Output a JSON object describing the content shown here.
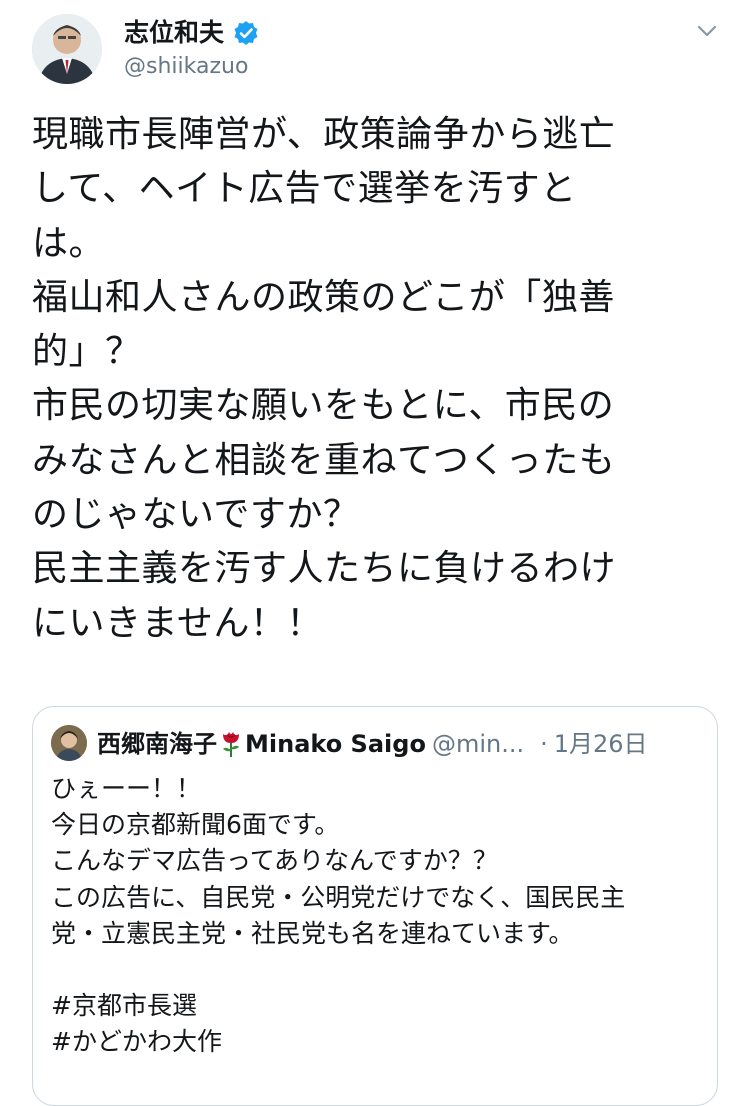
{
  "author": {
    "display_name": "志位和夫",
    "handle": "@shiikazuo",
    "verified": true
  },
  "tweet": {
    "text": "現職市長陣営が、政策論争から逃亡\nして、ヘイト広告で選挙を汚すと\nは。\n福山和人さんの政策のどこが「独善\n的」？\n市民の切実な願いをもとに、市民の\nみなさんと相談を重ねてつくったも\nのじゃないですか？\n民主主義を汚す人たちに負けるわけ\nにいきません！！"
  },
  "quoted_tweet": {
    "display_name": "西郷南海子",
    "display_name_latin": "Minako Saigo",
    "handle": "@min...",
    "separator": "·",
    "date": "1月26日",
    "text": "ひぇーー！！\n今日の京都新聞6面です。\nこんなデマ広告ってありなんですか？？\nこの広告に、自民党・公明党だけでなく、国民民主\n党・立憲民主党・社民党も名を連ねています。\n\n#京都市長選\n#かどかわ大作"
  },
  "colors": {
    "verified_badge": "#1da1f2",
    "secondary_text": "#657786",
    "border": "#ccd6dd",
    "rose": "#c8102e"
  },
  "icons": {
    "verified": "verified-badge-icon",
    "menu": "chevron-down-icon",
    "rose": "rose-emoji-icon"
  }
}
